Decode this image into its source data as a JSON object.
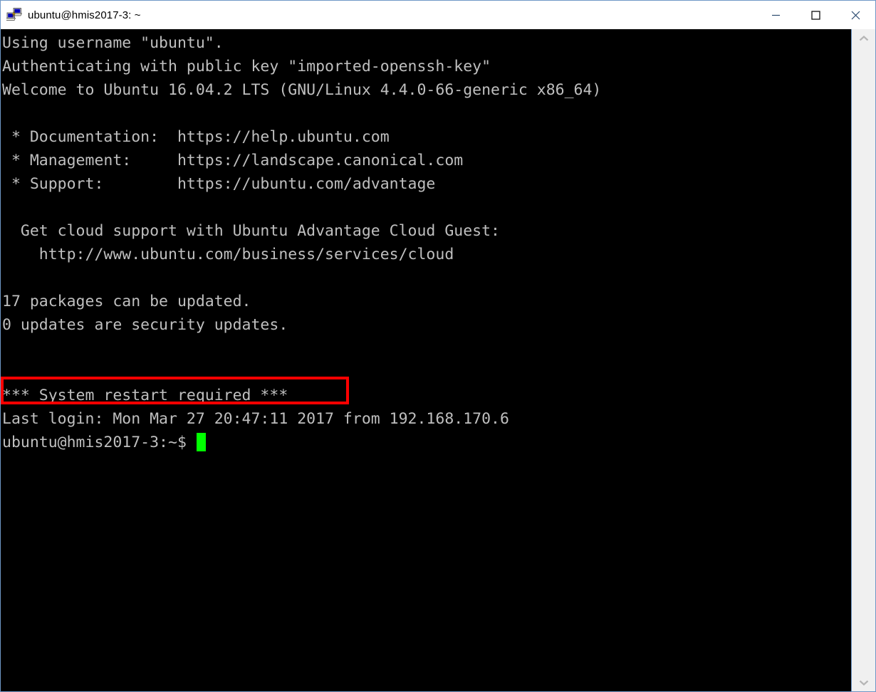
{
  "window": {
    "title": "ubuntu@hmis2017-3: ~",
    "icon": "putty-computers-icon",
    "minimize_label": "Minimize",
    "maximize_label": "Maximize",
    "close_label": "Close"
  },
  "terminal": {
    "background_color": "#000000",
    "text_color": "#bfbfbf",
    "cursor_color": "#00ff00",
    "lines": [
      "Using username \"ubuntu\".",
      "Authenticating with public key \"imported-openssh-key\"",
      "Welcome to Ubuntu 16.04.2 LTS (GNU/Linux 4.4.0-66-generic x86_64)",
      "",
      " * Documentation:  https://help.ubuntu.com",
      " * Management:     https://landscape.canonical.com",
      " * Support:        https://ubuntu.com/advantage",
      "",
      "  Get cloud support with Ubuntu Advantage Cloud Guest:",
      "    http://www.ubuntu.com/business/services/cloud",
      "",
      "17 packages can be updated.",
      "0 updates are security updates.",
      "",
      "",
      "*** System restart required ***",
      "Last login: Mon Mar 27 20:47:11 2017 from 192.168.170.6"
    ],
    "prompt": "ubuntu@hmis2017-3:~$ "
  },
  "annotation": {
    "highlight_color": "#ff0000",
    "highlighted_text": "*** System restart required ***"
  },
  "scrollbar": {
    "up_arrow": "chevron-up-icon",
    "down_arrow": "chevron-down-icon"
  }
}
